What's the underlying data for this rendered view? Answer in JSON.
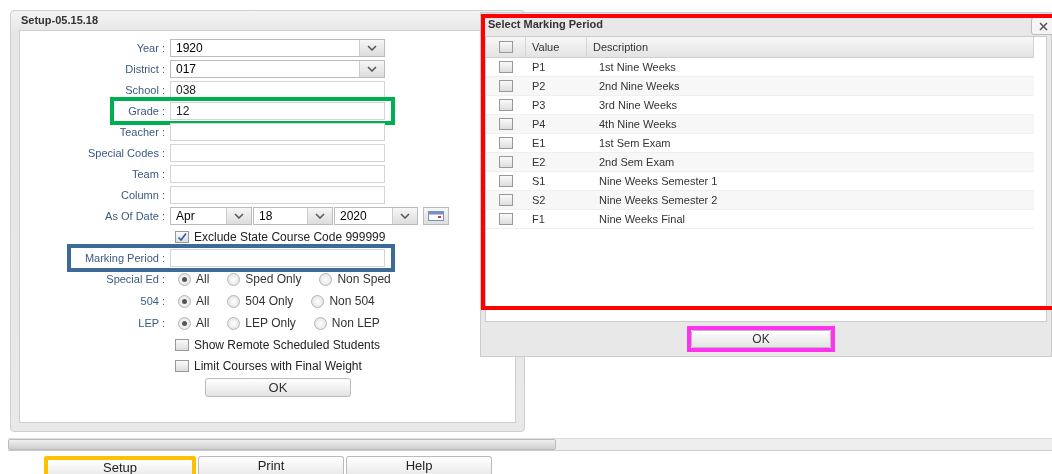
{
  "setup_panel": {
    "title": "Setup-05.15.18",
    "rows": [
      {
        "kind": "dropdown",
        "label": "Year :",
        "value": "1920"
      },
      {
        "kind": "dropdown",
        "label": "District :",
        "value": "017"
      },
      {
        "kind": "text",
        "label": "School :",
        "value": "038"
      },
      {
        "kind": "text",
        "label": "Grade :",
        "value": "12",
        "color": "#00b050"
      },
      {
        "kind": "text",
        "label": "Teacher :"
      },
      {
        "kind": "text",
        "label": "Special Codes :"
      },
      {
        "kind": "text",
        "label": "Team :"
      },
      {
        "kind": "text",
        "label": "Column :"
      },
      {
        "kind": "date",
        "label": "As Of Date :",
        "parts": [
          "Apr",
          "18",
          "2020"
        ]
      },
      {
        "kind": "checkbox",
        "text": "Exclude State Course Code 999999",
        "checked": true
      },
      {
        "kind": "text",
        "label": "Marking Period :",
        "color": "#3d6a99"
      },
      {
        "kind": "radio",
        "label": "Special Ed :",
        "options": [
          {
            "label": "All",
            "selected": true
          },
          {
            "label": "Sped Only",
            "selected": false
          },
          {
            "label": "Non Sped",
            "selected": false
          }
        ]
      },
      {
        "kind": "radio",
        "label": "504 :",
        "options": [
          {
            "label": "All",
            "selected": true
          },
          {
            "label": "504 Only",
            "selected": false
          },
          {
            "label": "Non 504",
            "selected": false
          }
        ]
      },
      {
        "kind": "radio",
        "label": "LEP :",
        "options": [
          {
            "label": "All",
            "selected": true
          },
          {
            "label": "LEP Only",
            "selected": false
          },
          {
            "label": "Non LEP",
            "selected": false
          }
        ]
      },
      {
        "kind": "checkbox",
        "text": "Show Remote Scheduled Students",
        "checked": false
      },
      {
        "kind": "checkbox",
        "text": "Limit Courses with Final Weight",
        "checked": false
      }
    ],
    "ok": "OK"
  },
  "marking_dialog": {
    "title": "Select Marking Period",
    "color": "#ff0000",
    "header_checked": false,
    "columns": [
      "Value",
      "Description"
    ],
    "rows": [
      {
        "value": "P1",
        "description": "1st Nine Weeks",
        "checked": false
      },
      {
        "value": "P2",
        "description": "2nd Nine Weeks",
        "checked": false
      },
      {
        "value": "P3",
        "description": "3rd Nine Weeks",
        "checked": false
      },
      {
        "value": "P4",
        "description": "4th Nine Weeks",
        "checked": false
      },
      {
        "value": "E1",
        "description": "1st Sem Exam",
        "checked": false
      },
      {
        "value": "E2",
        "description": "2nd Sem Exam",
        "checked": false
      },
      {
        "value": "S1",
        "description": "Nine Weeks Semester 1",
        "checked": false
      },
      {
        "value": "S2",
        "description": "Nine Weeks Semester 2",
        "checked": false
      },
      {
        "value": "F1",
        "description": "Nine Weeks Final",
        "checked": false
      }
    ],
    "ok_button": {
      "label": "OK",
      "color": "#ff33ee"
    }
  },
  "bottom_buttons": [
    {
      "label": "Setup",
      "color": "#ffc000"
    },
    {
      "label": "Print"
    },
    {
      "label": "Help"
    }
  ]
}
